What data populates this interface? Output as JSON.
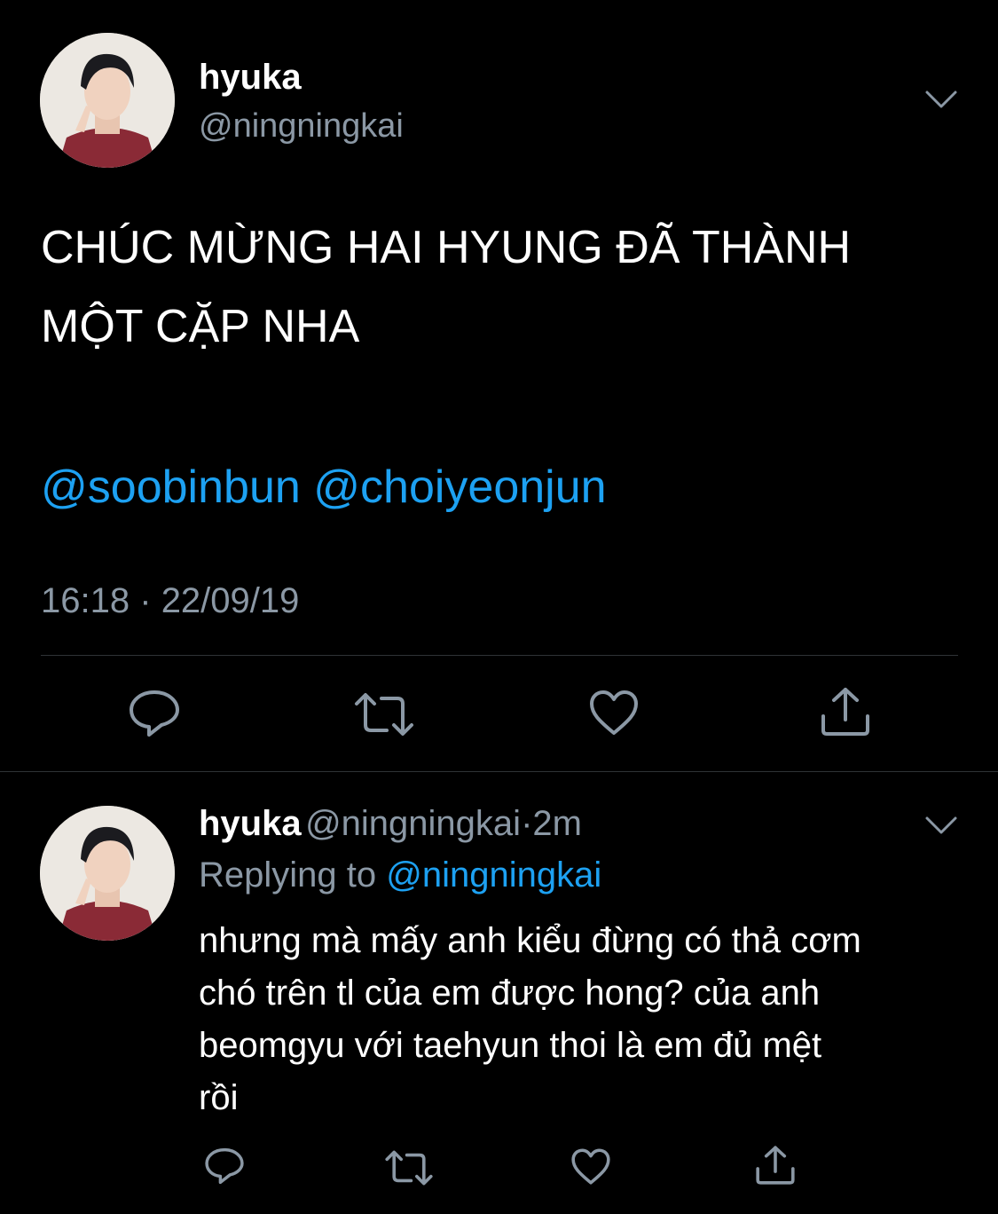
{
  "main_tweet": {
    "display_name": "hyuka",
    "handle": "@ningningkai",
    "text_line1": "CHÚC MỪNG HAI HYUNG ĐÃ THÀNH",
    "text_line2": "MỘT CẶP NHA",
    "mentions": [
      "@soobinbun",
      "@choiyeonjun"
    ],
    "time": "16:18",
    "separator": "·",
    "date": "22/09/19",
    "actions": [
      "reply-icon",
      "retweet-icon",
      "like-icon",
      "share-icon"
    ]
  },
  "reply": {
    "display_name": "hyuka",
    "handle": "@ningningkai",
    "dot": "·",
    "age": "2m",
    "replying_label": "Replying to",
    "replying_handle": "@ningningkai",
    "lines": [
      "nhưng mà mấy anh kiểu đừng có thả cơm",
      "chó trên tl của em được hong? của anh",
      "beomgyu với taehyun thoi là em đủ mệt",
      "rồi"
    ],
    "actions": [
      "reply-icon",
      "retweet-icon",
      "like-icon",
      "share-icon"
    ]
  },
  "colors": {
    "background": "#000000",
    "text": "#ffffff",
    "secondary": "#8b98a5",
    "accent": "#1da1f2",
    "divider": "#2f3336"
  }
}
